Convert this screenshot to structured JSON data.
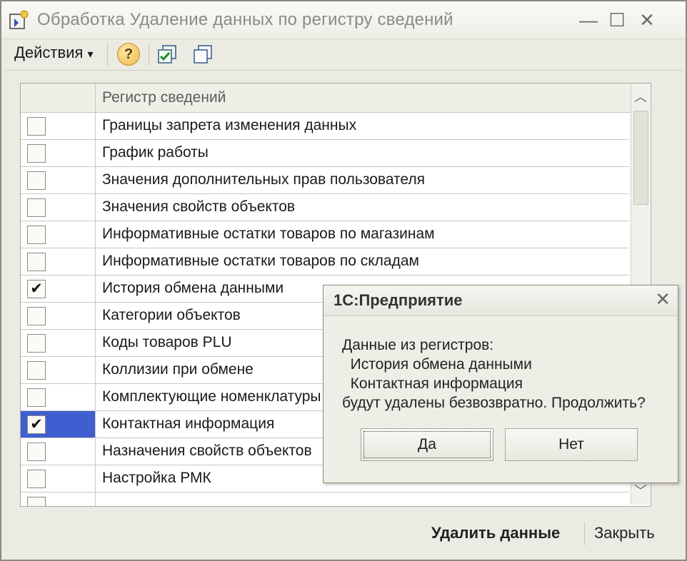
{
  "window": {
    "title": "Обработка Удаление данных по регистру сведений",
    "controls": {
      "minimize": "—",
      "maximize": "☐",
      "close": "✕"
    }
  },
  "toolbar": {
    "actions_label": "Действия",
    "actions_arrow": "▾",
    "help_label": "?"
  },
  "grid": {
    "header_label": "Регистр сведений",
    "rows": [
      {
        "name": "Границы запрета изменения данных",
        "checked": false
      },
      {
        "name": "График работы",
        "checked": false
      },
      {
        "name": "Значения дополнительных прав пользователя",
        "checked": false
      },
      {
        "name": "Значения свойств объектов",
        "checked": false
      },
      {
        "name": "Информативные остатки товаров по магазинам",
        "checked": false
      },
      {
        "name": "Информативные остатки товаров по складам",
        "checked": false
      },
      {
        "name": "История обмена данными",
        "checked": true
      },
      {
        "name": "Категории объектов",
        "checked": false
      },
      {
        "name": "Коды товаров PLU",
        "checked": false
      },
      {
        "name": "Коллизии при обмене",
        "checked": false
      },
      {
        "name": "Комплектующие номенклатуры",
        "checked": false
      },
      {
        "name": "Контактная информация",
        "checked": true,
        "selected": true
      },
      {
        "name": "Назначения свойств объектов",
        "checked": false
      },
      {
        "name": "Настройка РМК",
        "checked": false
      },
      {
        "name": "",
        "checked": false
      }
    ]
  },
  "bottom": {
    "delete_label": "Удалить данные",
    "close_label": "Закрыть"
  },
  "dialog": {
    "title": "1С:Предприятие",
    "close_glyph": "✕",
    "message": "Данные из регистров:\n  История обмена данными\n  Контактная информация\nбудут удалены безвозвратно. Продолжить?",
    "yes_label": "Да",
    "no_label": "Нет"
  },
  "colors": {
    "selection": "#3f5fd0",
    "window_bg": "#ecebe3"
  }
}
